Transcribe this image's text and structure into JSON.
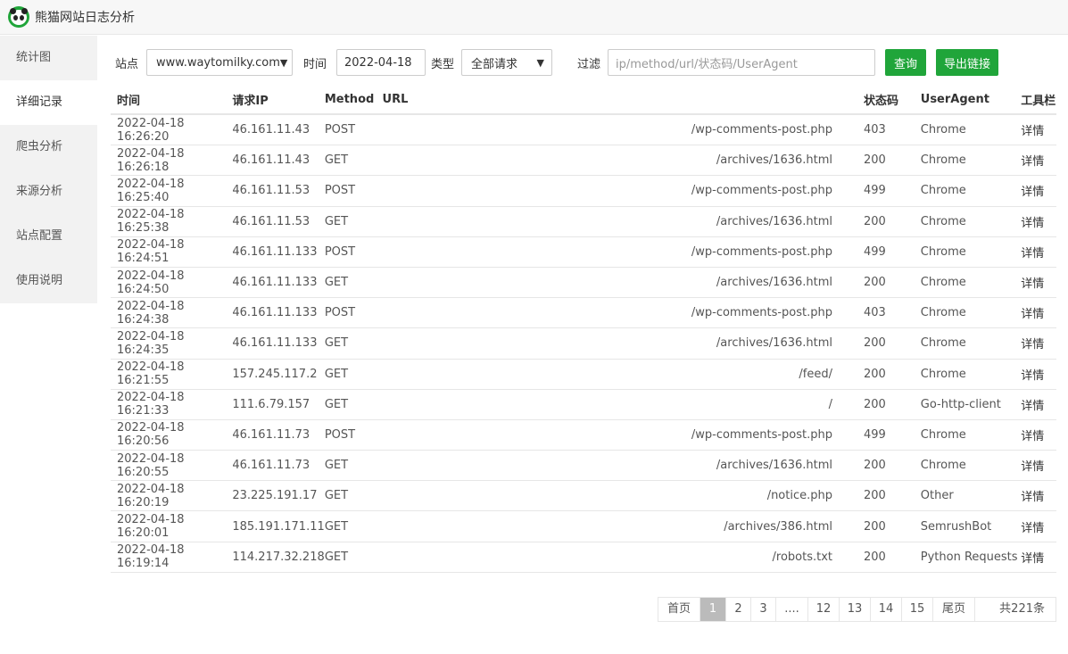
{
  "window": {
    "title": "熊猫网站日志分析"
  },
  "sidebar": {
    "items": [
      {
        "label": "统计图"
      },
      {
        "label": "详细记录",
        "active": true
      },
      {
        "label": "爬虫分析"
      },
      {
        "label": "来源分析"
      },
      {
        "label": "站点配置"
      },
      {
        "label": "使用说明"
      }
    ]
  },
  "toolbar": {
    "site_label": "站点",
    "site_value": "www.waytomilky.com",
    "time_label": "时间",
    "time_value": "2022-04-18",
    "type_label": "类型",
    "type_value": "全部请求",
    "filter_label": "过滤",
    "filter_placeholder": "ip/method/url/状态码/UserAgent",
    "query_button": "查询",
    "export_button": "导出链接"
  },
  "table": {
    "headers": {
      "time": "时间",
      "ip": "请求IP",
      "method": "Method",
      "url": "URL",
      "status": "状态码",
      "ua": "UserAgent",
      "tool": "工具栏"
    },
    "rows": [
      {
        "time": "2022-04-18 16:26:20",
        "ip": "46.161.11.43",
        "method": "POST",
        "url": "/wp-comments-post.php",
        "status": "403",
        "ua": "Chrome",
        "tool": "详情"
      },
      {
        "time": "2022-04-18 16:26:18",
        "ip": "46.161.11.43",
        "method": "GET",
        "url": "/archives/1636.html",
        "status": "200",
        "ua": "Chrome",
        "tool": "详情"
      },
      {
        "time": "2022-04-18 16:25:40",
        "ip": "46.161.11.53",
        "method": "POST",
        "url": "/wp-comments-post.php",
        "status": "499",
        "ua": "Chrome",
        "tool": "详情"
      },
      {
        "time": "2022-04-18 16:25:38",
        "ip": "46.161.11.53",
        "method": "GET",
        "url": "/archives/1636.html",
        "status": "200",
        "ua": "Chrome",
        "tool": "详情"
      },
      {
        "time": "2022-04-18 16:24:51",
        "ip": "46.161.11.133",
        "method": "POST",
        "url": "/wp-comments-post.php",
        "status": "499",
        "ua": "Chrome",
        "tool": "详情"
      },
      {
        "time": "2022-04-18 16:24:50",
        "ip": "46.161.11.133",
        "method": "GET",
        "url": "/archives/1636.html",
        "status": "200",
        "ua": "Chrome",
        "tool": "详情"
      },
      {
        "time": "2022-04-18 16:24:38",
        "ip": "46.161.11.133",
        "method": "POST",
        "url": "/wp-comments-post.php",
        "status": "403",
        "ua": "Chrome",
        "tool": "详情"
      },
      {
        "time": "2022-04-18 16:24:35",
        "ip": "46.161.11.133",
        "method": "GET",
        "url": "/archives/1636.html",
        "status": "200",
        "ua": "Chrome",
        "tool": "详情"
      },
      {
        "time": "2022-04-18 16:21:55",
        "ip": "157.245.117.2",
        "method": "GET",
        "url": "/feed/",
        "status": "200",
        "ua": "Chrome",
        "tool": "详情"
      },
      {
        "time": "2022-04-18 16:21:33",
        "ip": "111.6.79.157",
        "method": "GET",
        "url": "/",
        "status": "200",
        "ua": "Go-http-client",
        "tool": "详情"
      },
      {
        "time": "2022-04-18 16:20:56",
        "ip": "46.161.11.73",
        "method": "POST",
        "url": "/wp-comments-post.php",
        "status": "499",
        "ua": "Chrome",
        "tool": "详情"
      },
      {
        "time": "2022-04-18 16:20:55",
        "ip": "46.161.11.73",
        "method": "GET",
        "url": "/archives/1636.html",
        "status": "200",
        "ua": "Chrome",
        "tool": "详情"
      },
      {
        "time": "2022-04-18 16:20:19",
        "ip": "23.225.191.17",
        "method": "GET",
        "url": "/notice.php",
        "status": "200",
        "ua": "Other",
        "tool": "详情"
      },
      {
        "time": "2022-04-18 16:20:01",
        "ip": "185.191.171.11",
        "method": "GET",
        "url": "/archives/386.html",
        "status": "200",
        "ua": "SemrushBot",
        "tool": "详情"
      },
      {
        "time": "2022-04-18 16:19:14",
        "ip": "114.217.32.218",
        "method": "GET",
        "url": "/robots.txt",
        "status": "200",
        "ua": "Python Requests",
        "tool": "详情"
      }
    ]
  },
  "pagination": {
    "first": "首页",
    "pages": [
      "1",
      "2",
      "3",
      "....",
      "12",
      "13",
      "14",
      "15"
    ],
    "current": "1",
    "last": "尾页",
    "total": "共221条"
  },
  "colors": {
    "accent": "#20a53a",
    "sidebar_bg": "#f2f2f2",
    "page_active": "#bbbbbb"
  }
}
